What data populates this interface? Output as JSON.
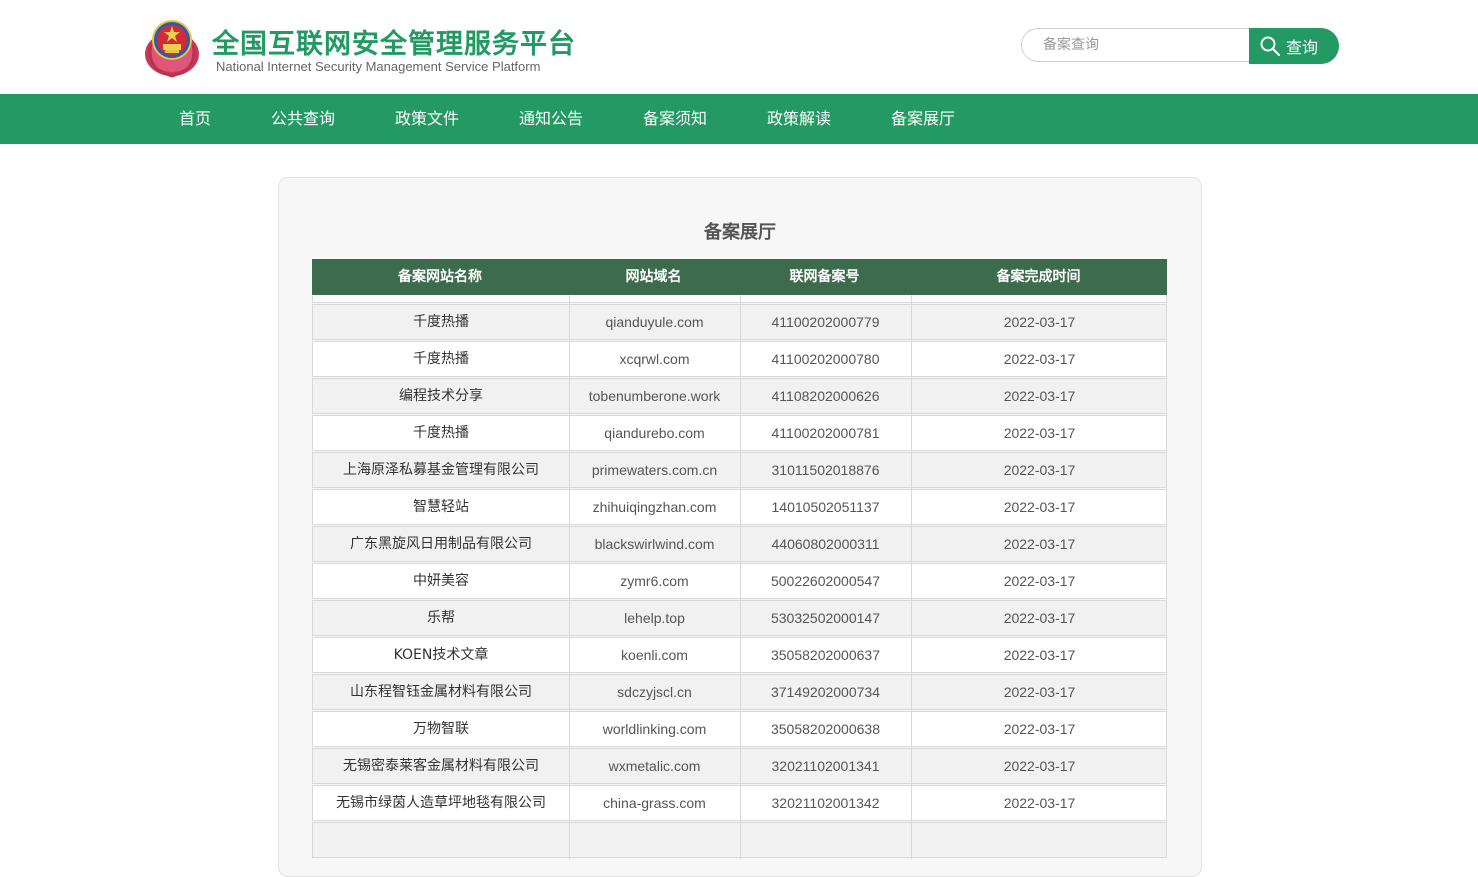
{
  "header": {
    "title_cn": "全国互联网安全管理服务平台",
    "title_en": "National Internet Security Management Service Platform",
    "search_placeholder": "备案查询",
    "search_button_label": "查询"
  },
  "nav": {
    "items": [
      "首页",
      "公共查询",
      "政策文件",
      "通知公告",
      "备案须知",
      "政策解读",
      "备案展厅"
    ]
  },
  "panel": {
    "title": "备案展厅",
    "columns": [
      "备案网站名称",
      "网站域名",
      "联网备案号",
      "备案完成时间"
    ],
    "rows": [
      [
        "千度热播",
        "qianduyule.com",
        "41100202000779",
        "2022-03-17"
      ],
      [
        "千度热播",
        "xcqrwl.com",
        "41100202000780",
        "2022-03-17"
      ],
      [
        "编程技术分享",
        "tobenumberone.work",
        "41108202000626",
        "2022-03-17"
      ],
      [
        "千度热播",
        "qiandurebo.com",
        "41100202000781",
        "2022-03-17"
      ],
      [
        "上海原泽私募基金管理有限公司",
        "primewaters.com.cn",
        "31011502018876",
        "2022-03-17"
      ],
      [
        "智慧轻站",
        "zhihuiqingzhan.com",
        "14010502051137",
        "2022-03-17"
      ],
      [
        "广东黑旋风日用制品有限公司",
        "blackswirlwind.com",
        "44060802000311",
        "2022-03-17"
      ],
      [
        "中妍美容",
        "zymr6.com",
        "50022602000547",
        "2022-03-17"
      ],
      [
        "乐帮",
        "lehelp.top",
        "53032502000147",
        "2022-03-17"
      ],
      [
        "KOEN技术文章",
        "koenli.com",
        "35058202000637",
        "2022-03-17"
      ],
      [
        "山东程智钰金属材料有限公司",
        "sdczyjscl.cn",
        "37149202000734",
        "2022-03-17"
      ],
      [
        "万物智联",
        "worldlinking.com",
        "35058202000638",
        "2022-03-17"
      ],
      [
        "无锡密泰莱客金属材料有限公司",
        "wxmetalic.com",
        "32021102001341",
        "2022-03-17"
      ],
      [
        "无锡市绿茵人造草坪地毯有限公司",
        "china-grass.com",
        "32021102001342",
        "2022-03-17"
      ]
    ]
  },
  "colors": {
    "brand_green": "#239a63",
    "table_header": "#3c6b4e"
  }
}
